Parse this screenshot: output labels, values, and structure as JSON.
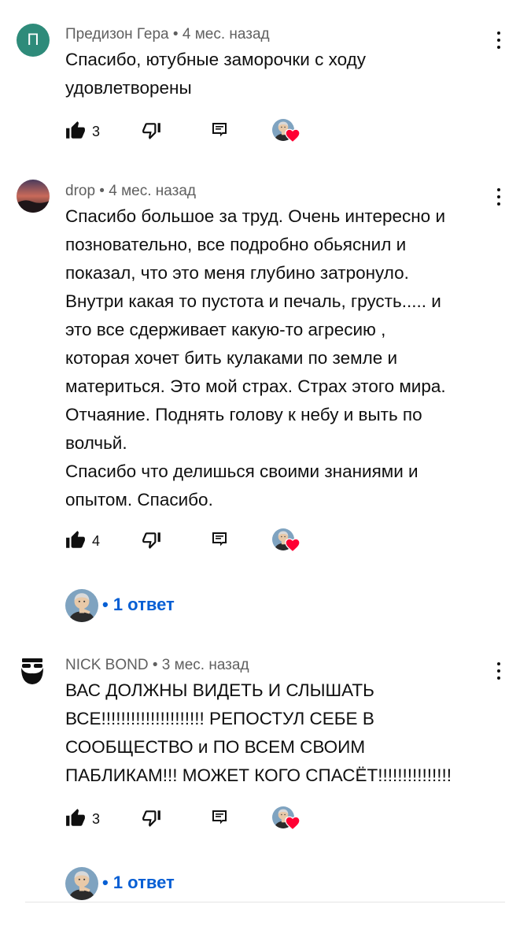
{
  "comments": [
    {
      "author": "Предизон Гера",
      "time": "4 мес. назад",
      "avatar_letter": "П",
      "avatar_color": "#2e8b7a",
      "lines": [
        "Спасибо, ютубные заморочки с  ходу",
        "удовлетворены"
      ],
      "likes": "3",
      "avatar_icon": "letter-avatar-icon"
    },
    {
      "author": "drop",
      "time": "4 мес. назад",
      "avatar_icon": "sunset-avatar-icon",
      "lines": [
        "Спасибо большое за труд. Очень интересно и",
        "позновательно, все подробно обьяснил и",
        "показал, что это меня глубино затронуло.",
        "Внутри какая то пустота и печаль, грусть..... и",
        "это все сдерживает какую-то агресию  ,",
        "которая хочет бить кулаками по земле и",
        "материться. Это мой страх. Страх этого мира.",
        "Отчаяние.  Поднять голову к небу и выть по",
        "волчьй.",
        "Спасибо что делишься своими знаниями и",
        "опытом.  Спасибо."
      ],
      "likes": "4",
      "replies": "1 ответ"
    },
    {
      "author": "NICK BOND",
      "time": "3 мес. назад",
      "avatar_icon": "beard-avatar-icon",
      "lines": [
        "ВАС ДОЛЖНЫ ВИДЕТЬ И СЛЫШАТЬ",
        "ВСЕ!!!!!!!!!!!!!!!!!!!!! РЕПОСТУЛ СЕБЕ В",
        "СООБЩЕСТВО и ПО ВСЕМ СВОИМ",
        "ПАБЛИКАМ!!! МОЖЕТ КОГО СПАСЁТ!!!!!!!!!!!!!!!"
      ],
      "likes": "3",
      "replies": "1 ответ"
    }
  ],
  "separator": " • ",
  "reply_prefix": "• ",
  "colors": {
    "meta": "#606060",
    "text": "#0f0f0f",
    "link": "#065fd4",
    "heart": "#ff0033"
  },
  "icons": [
    "like-icon",
    "dislike-icon",
    "reply-icon",
    "creator-heart-icon",
    "more-vert-icon"
  ]
}
